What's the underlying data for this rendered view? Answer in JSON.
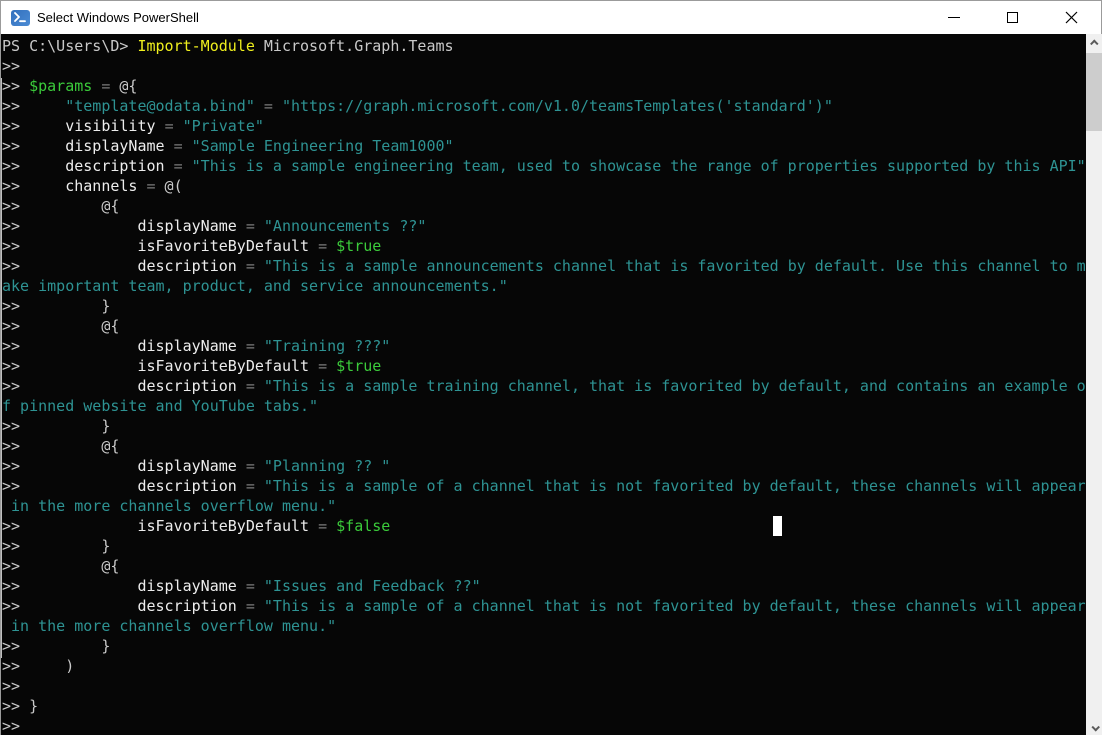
{
  "window": {
    "title": "Select Windows PowerShell"
  },
  "icons": {
    "powershell_logo": ">_",
    "minimize": "minimize-dash",
    "maximize": "maximize-square",
    "close": "close-x",
    "scroll_up": "chevron-up",
    "scroll_down": "chevron-down"
  },
  "terminal": {
    "colors": {
      "background": "#060606",
      "default": "#c9c9c9",
      "command": "#f0f01e",
      "variable": "#3bcb3b",
      "string": "#2e9393",
      "operator": "#7a7a7a",
      "member": "#ededed",
      "cursor": "#ffffff"
    },
    "rows": [
      [
        {
          "t": "PS C:\\Users\\D> ",
          "c": "default"
        },
        {
          "t": "Import-Module",
          "c": "command"
        },
        {
          "t": " Microsoft.Graph.Teams",
          "c": "default"
        }
      ],
      [
        {
          "t": ">>",
          "c": "default"
        }
      ],
      [
        {
          "t": ">> ",
          "c": "default"
        },
        {
          "t": "$params",
          "c": "variable"
        },
        {
          "t": " ",
          "c": "default"
        },
        {
          "t": "=",
          "c": "operator"
        },
        {
          "t": " @{",
          "c": "default"
        }
      ],
      [
        {
          "t": ">>     ",
          "c": "default"
        },
        {
          "t": "\"template@odata.bind\"",
          "c": "string"
        },
        {
          "t": " ",
          "c": "default"
        },
        {
          "t": "=",
          "c": "operator"
        },
        {
          "t": " ",
          "c": "default"
        },
        {
          "t": "\"https://graph.microsoft.com/v1.0/teamsTemplates('standard')\"",
          "c": "string"
        }
      ],
      [
        {
          "t": ">>     ",
          "c": "default"
        },
        {
          "t": "visibility",
          "c": "member"
        },
        {
          "t": " ",
          "c": "default"
        },
        {
          "t": "=",
          "c": "operator"
        },
        {
          "t": " ",
          "c": "default"
        },
        {
          "t": "\"Private\"",
          "c": "string"
        }
      ],
      [
        {
          "t": ">>     ",
          "c": "default"
        },
        {
          "t": "displayName",
          "c": "member"
        },
        {
          "t": " ",
          "c": "default"
        },
        {
          "t": "=",
          "c": "operator"
        },
        {
          "t": " ",
          "c": "default"
        },
        {
          "t": "\"Sample Engineering Team1000\"",
          "c": "string"
        }
      ],
      [
        {
          "t": ">>     ",
          "c": "default"
        },
        {
          "t": "description",
          "c": "member"
        },
        {
          "t": " ",
          "c": "default"
        },
        {
          "t": "=",
          "c": "operator"
        },
        {
          "t": " ",
          "c": "default"
        },
        {
          "t": "\"This is a sample engineering team, used to showcase the range of properties supported by this API\"",
          "c": "string"
        }
      ],
      [
        {
          "t": ">>     ",
          "c": "default"
        },
        {
          "t": "channels",
          "c": "member"
        },
        {
          "t": " ",
          "c": "default"
        },
        {
          "t": "=",
          "c": "operator"
        },
        {
          "t": " @(",
          "c": "default"
        }
      ],
      [
        {
          "t": ">>         @{",
          "c": "default"
        }
      ],
      [
        {
          "t": ">>             ",
          "c": "default"
        },
        {
          "t": "displayName",
          "c": "member"
        },
        {
          "t": " ",
          "c": "default"
        },
        {
          "t": "=",
          "c": "operator"
        },
        {
          "t": " ",
          "c": "default"
        },
        {
          "t": "\"Announcements ??\"",
          "c": "string"
        }
      ],
      [
        {
          "t": ">>             ",
          "c": "default"
        },
        {
          "t": "isFavoriteByDefault",
          "c": "member"
        },
        {
          "t": " ",
          "c": "default"
        },
        {
          "t": "=",
          "c": "operator"
        },
        {
          "t": " ",
          "c": "default"
        },
        {
          "t": "$true",
          "c": "variable"
        }
      ],
      [
        {
          "t": ">>             ",
          "c": "default"
        },
        {
          "t": "description",
          "c": "member"
        },
        {
          "t": " ",
          "c": "default"
        },
        {
          "t": "=",
          "c": "operator"
        },
        {
          "t": " ",
          "c": "default"
        },
        {
          "t": "\"This is a sample announcements channel that is favorited by default. Use this channel to m",
          "c": "string"
        }
      ],
      [
        {
          "t": "ake important team, product, and service announcements.\"",
          "c": "string"
        }
      ],
      [
        {
          "t": ">>         }",
          "c": "default"
        }
      ],
      [
        {
          "t": ">>         @{",
          "c": "default"
        }
      ],
      [
        {
          "t": ">>             ",
          "c": "default"
        },
        {
          "t": "displayName",
          "c": "member"
        },
        {
          "t": " ",
          "c": "default"
        },
        {
          "t": "=",
          "c": "operator"
        },
        {
          "t": " ",
          "c": "default"
        },
        {
          "t": "\"Training ???\"",
          "c": "string"
        }
      ],
      [
        {
          "t": ">>             ",
          "c": "default"
        },
        {
          "t": "isFavoriteByDefault",
          "c": "member"
        },
        {
          "t": " ",
          "c": "default"
        },
        {
          "t": "=",
          "c": "operator"
        },
        {
          "t": " ",
          "c": "default"
        },
        {
          "t": "$true",
          "c": "variable"
        }
      ],
      [
        {
          "t": ">>             ",
          "c": "default"
        },
        {
          "t": "description",
          "c": "member"
        },
        {
          "t": " ",
          "c": "default"
        },
        {
          "t": "=",
          "c": "operator"
        },
        {
          "t": " ",
          "c": "default"
        },
        {
          "t": "\"This is a sample training channel, that is favorited by default, and contains an example o",
          "c": "string"
        }
      ],
      [
        {
          "t": "f pinned website and YouTube tabs.\"",
          "c": "string"
        }
      ],
      [
        {
          "t": ">>         }",
          "c": "default"
        }
      ],
      [
        {
          "t": ">>         @{",
          "c": "default"
        }
      ],
      [
        {
          "t": ">>             ",
          "c": "default"
        },
        {
          "t": "displayName",
          "c": "member"
        },
        {
          "t": " ",
          "c": "default"
        },
        {
          "t": "=",
          "c": "operator"
        },
        {
          "t": " ",
          "c": "default"
        },
        {
          "t": "\"Planning ?? \"",
          "c": "string"
        }
      ],
      [
        {
          "t": ">>             ",
          "c": "default"
        },
        {
          "t": "description",
          "c": "member"
        },
        {
          "t": " ",
          "c": "default"
        },
        {
          "t": "=",
          "c": "operator"
        },
        {
          "t": " ",
          "c": "default"
        },
        {
          "t": "\"This is a sample of a channel that is not favorited by default, these channels will appear",
          "c": "string"
        }
      ],
      [
        {
          "t": " in the more channels overflow menu.\"",
          "c": "string"
        }
      ],
      [
        {
          "t": ">>             ",
          "c": "default"
        },
        {
          "t": "isFavoriteByDefault",
          "c": "member"
        },
        {
          "t": " ",
          "c": "default"
        },
        {
          "t": "=",
          "c": "operator"
        },
        {
          "t": " ",
          "c": "default"
        },
        {
          "t": "$false",
          "c": "variable"
        }
      ],
      [
        {
          "t": ">>         }",
          "c": "default"
        }
      ],
      [
        {
          "t": ">>         @{",
          "c": "default"
        }
      ],
      [
        {
          "t": ">>             ",
          "c": "default"
        },
        {
          "t": "displayName",
          "c": "member"
        },
        {
          "t": " ",
          "c": "default"
        },
        {
          "t": "=",
          "c": "operator"
        },
        {
          "t": " ",
          "c": "default"
        },
        {
          "t": "\"Issues and Feedback ??\"",
          "c": "string"
        }
      ],
      [
        {
          "t": ">>             ",
          "c": "default"
        },
        {
          "t": "description",
          "c": "member"
        },
        {
          "t": " ",
          "c": "default"
        },
        {
          "t": "=",
          "c": "operator"
        },
        {
          "t": " ",
          "c": "default"
        },
        {
          "t": "\"This is a sample of a channel that is not favorited by default, these channels will appear",
          "c": "string"
        }
      ],
      [
        {
          "t": " in the more channels overflow menu.\"",
          "c": "string"
        }
      ],
      [
        {
          "t": ">>         }",
          "c": "default"
        }
      ],
      [
        {
          "t": ">>     )",
          "c": "default"
        }
      ],
      [
        {
          "t": ">>",
          "c": "default"
        }
      ],
      [
        {
          "t": ">> }",
          "c": "default"
        }
      ],
      [
        {
          "t": ">>",
          "c": "default"
        }
      ]
    ]
  }
}
